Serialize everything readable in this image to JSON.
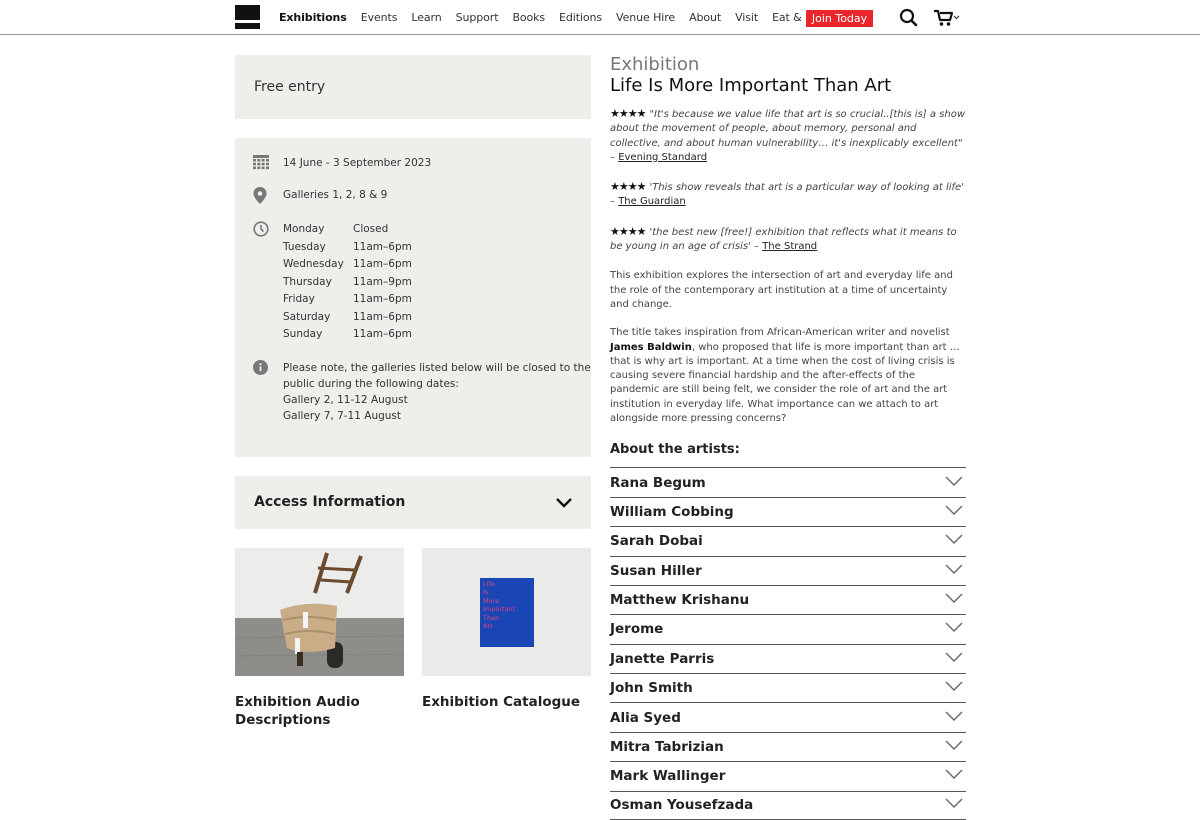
{
  "header": {
    "logo": "site-logo",
    "nav": [
      {
        "label": "Exhibitions",
        "active": true
      },
      {
        "label": "Events"
      },
      {
        "label": "Learn"
      },
      {
        "label": "Support"
      },
      {
        "label": "Books"
      },
      {
        "label": "Editions"
      },
      {
        "label": "Venue Hire"
      },
      {
        "label": "About"
      },
      {
        "label": "Visit"
      },
      {
        "label": "Eat & Drink"
      }
    ],
    "join_label": "Join Today",
    "join_color": "#e8262b",
    "search_icon": "search-icon",
    "cart_icon": "cart-icon"
  },
  "left": {
    "free_entry": "Free entry",
    "dates": "14 June - 3 September 2023",
    "location": "Galleries 1, 2, 8 & 9",
    "hours": [
      {
        "day": "Monday",
        "time": "Closed"
      },
      {
        "day": "Tuesday",
        "time": "11am–6pm"
      },
      {
        "day": "Wednesday",
        "time": "11am–6pm"
      },
      {
        "day": "Thursday",
        "time": "11am–9pm"
      },
      {
        "day": "Friday",
        "time": "11am–6pm"
      },
      {
        "day": "Saturday",
        "time": "11am–6pm"
      },
      {
        "day": "Sunday",
        "time": "11am–6pm"
      }
    ],
    "notice": [
      "Please note, the galleries listed below will be closed to the",
      "public during the following dates:",
      "Gallery 2, 11-12 August",
      "Gallery 7, 7-11 August"
    ],
    "access_label": "Access Information",
    "cards": [
      {
        "caption_1": "Exhibition Audio",
        "caption_2": "Descriptions"
      },
      {
        "caption_1": "Exhibition Catalogue",
        "cover_text": [
          "Life",
          "Is",
          "More",
          "Important",
          "Than",
          "Art"
        ]
      }
    ]
  },
  "right": {
    "kicker": "Exhibition",
    "title": "Life Is More Important Than Art",
    "reviews": [
      {
        "stars": "★★★★",
        "rating": 4,
        "quote": "\"It's because we value life that art is so crucial..[this is] a show about the movement of people, about memory, personal and collective, and about human vulnerability… it's inexplicably excellent\" – ",
        "source": "Evening Standard"
      },
      {
        "stars": "★★★★",
        "rating": 4,
        "quote": "'This show reveals that art is a particular way of looking at life' – ",
        "source": "The Guardian"
      },
      {
        "stars": "★★★★",
        "rating": 4,
        "quote": "'the best new [free!] exhibition that reflects what it means to be young in an age of crisis' – ",
        "source": "The Strand"
      }
    ],
    "para1": "This exhibition explores the intersection of art and everyday life and the role of the contemporary art institution at a time of uncertainty and change.",
    "para2_a": "The title takes inspiration from African-American writer and novelist ",
    "para2_bold": "James Baldwin",
    "para2_b": ", who proposed that life is more important than art … that is why art is important. At a time when the cost of living crisis is causing severe financial hardship and the after-effects of the pandemic are still being felt, we consider the role of art and the art institution in everyday life. What importance can we attach to art alongside more pressing concerns?",
    "about_heading": "About the artists:",
    "artists": [
      "Rana Begum",
      "William Cobbing",
      "Sarah Dobai",
      "Susan Hiller",
      "Matthew Krishanu",
      "Jerome",
      "Janette Parris",
      "John Smith",
      "Alia Syed",
      "Mitra Tabrizian",
      "Mark Wallinger",
      "Osman Yousefzada"
    ]
  }
}
